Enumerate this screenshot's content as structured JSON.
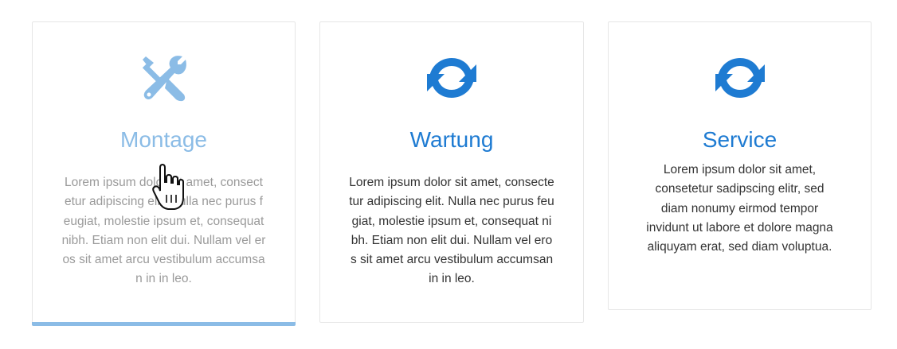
{
  "cards": [
    {
      "icon": "wrench-screwdriver-icon",
      "title": "Montage",
      "text": "Lorem ipsum dolor sit amet, consectetur adipiscing elit. Nulla nec purus feugiat, molestie ipsum et, consequat nibh. Etiam non elit dui. Nullam vel eros sit amet arcu vestibulum accumsan in in leo.",
      "state": "hovered"
    },
    {
      "icon": "refresh-icon",
      "title": "Wartung",
      "text": "Lorem ipsum dolor sit amet, consectetur adipiscing elit. Nulla nec purus feugiat, molestie ipsum et, consequat nibh. Etiam non elit dui. Nullam vel eros sit amet arcu vestibulum accumsan in in leo."
    },
    {
      "icon": "refresh-icon",
      "title": "Service",
      "text": "Lorem ipsum dolor sit amet, consetetur sadipscing elitr, sed diam nonumy eirmod tempor invidunt ut labore et dolore magna aliquyam erat, sed diam voluptua."
    }
  ],
  "colors": {
    "accent": "#1e7bd2",
    "accent_light": "#8bbce6",
    "text": "#333333",
    "text_muted": "#9a9a9a"
  }
}
